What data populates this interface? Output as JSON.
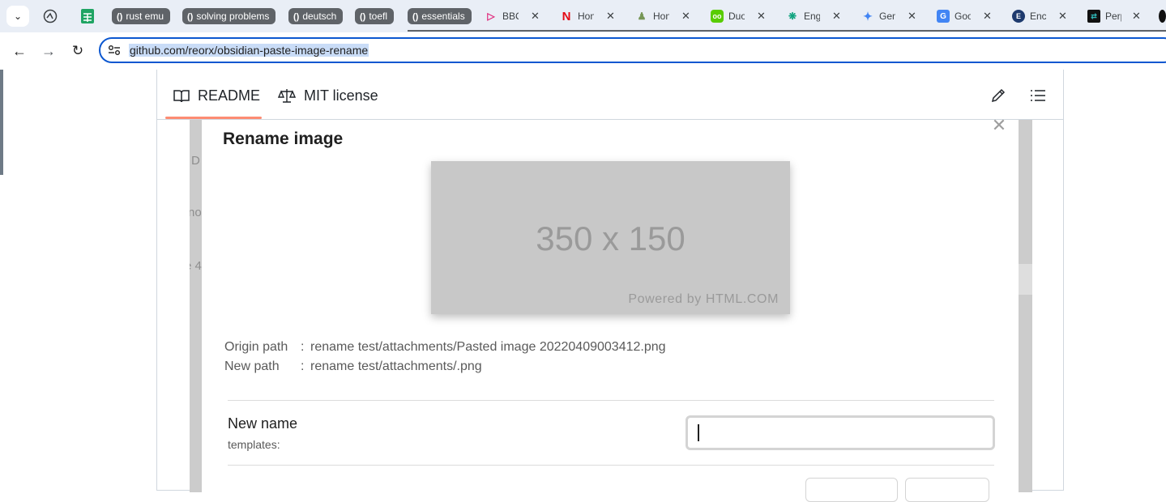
{
  "browser": {
    "tab_groups": [
      {
        "label": "rust emu"
      },
      {
        "label": "solving problems"
      },
      {
        "label": "deutsch"
      },
      {
        "label": "toefl"
      },
      {
        "label": "essentials"
      }
    ],
    "tabs": [
      {
        "title": "BBC",
        "icon": "bbc-icon"
      },
      {
        "title": "Hon",
        "icon": "netflix-icon"
      },
      {
        "title": "Hon",
        "icon": "chess-icon"
      },
      {
        "title": "Duo",
        "icon": "duolingo-icon"
      },
      {
        "title": "Engl",
        "icon": "chatgpt-icon"
      },
      {
        "title": "Gem",
        "icon": "gemini-icon"
      },
      {
        "title": "Goo",
        "icon": "google-translate-icon"
      },
      {
        "title": "Ency",
        "icon": "encyclopedia-icon"
      },
      {
        "title": "Perp",
        "icon": "perplexity-icon"
      }
    ],
    "url": "github.com/reorx/obsidian-paste-image-rename",
    "colors": {
      "omnibox_border": "#0b57d0",
      "tab_group": "#5f6368",
      "url_highlight": "#c9dcf7"
    }
  },
  "readme": {
    "tabs": [
      {
        "label": "README",
        "active": true
      },
      {
        "label": "MIT license",
        "active": false
      }
    ],
    "accent": "#fd8c73",
    "background_fragments": [
      "D",
      "no",
      "e 4"
    ]
  },
  "modal": {
    "title": "Rename image",
    "preview": {
      "size_text": "350 x 150",
      "powered_text": "Powered by HTML.COM"
    },
    "origin_path": {
      "label": "Origin path",
      "separator": ":",
      "value": "rename test/attachments/Pasted image 20220409003412.png"
    },
    "new_path": {
      "label": "New path",
      "separator": ":",
      "value": "rename test/attachments/.png"
    },
    "new_name": {
      "label": "New name",
      "description": "templates:",
      "value": ""
    }
  }
}
